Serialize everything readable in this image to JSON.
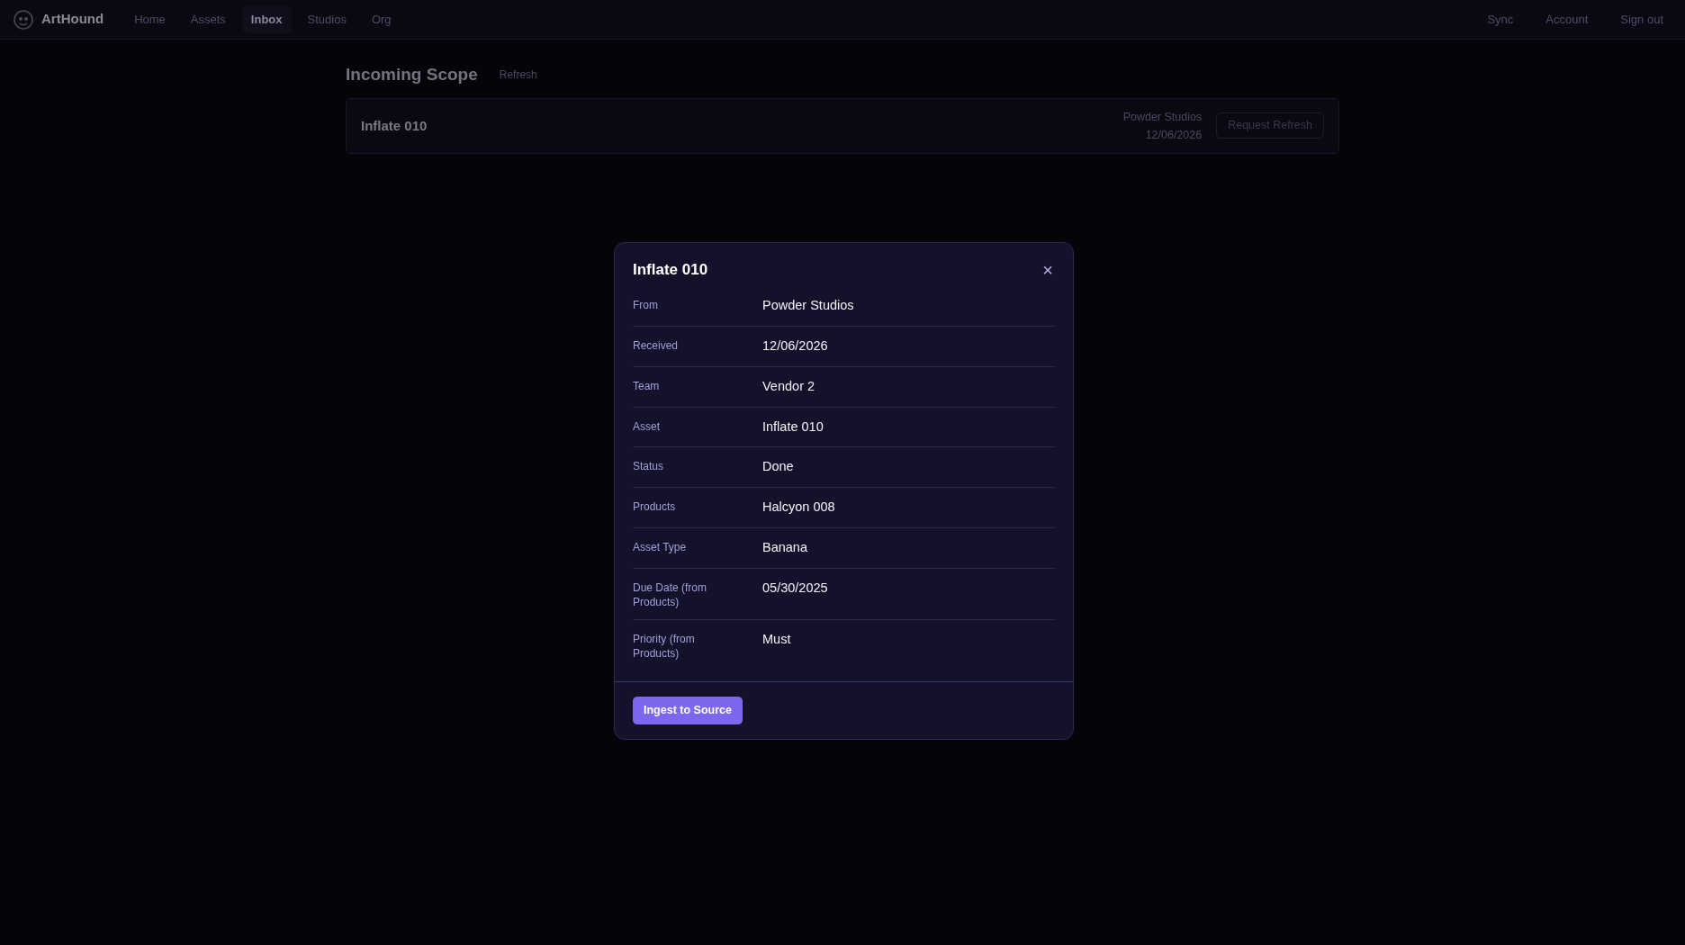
{
  "navbar": {
    "brand": "ArtHound",
    "links": [
      {
        "label": "Home",
        "selected": false
      },
      {
        "label": "Assets",
        "selected": false
      },
      {
        "label": "Inbox",
        "selected": true
      },
      {
        "label": "Studios",
        "selected": false
      },
      {
        "label": "Org",
        "selected": false
      }
    ],
    "right_links": [
      "Sync",
      "Account",
      "Sign out"
    ]
  },
  "page": {
    "title": "Incoming Scope",
    "refresh": "Refresh",
    "items": [
      {
        "name": "Inflate 010",
        "from": "Powder Studios",
        "date": "12/06/2026",
        "action": "Request Refresh",
        "action_disabled": true
      }
    ]
  },
  "modal": {
    "title": "Inflate 010",
    "close": "×",
    "fields": [
      {
        "label": "From",
        "value": "Powder Studios"
      },
      {
        "label": "Received",
        "value": "12/06/2026"
      },
      {
        "label": "Team",
        "value": "Vendor 2"
      },
      {
        "label": "Asset",
        "value": "Inflate 010"
      },
      {
        "label": "Status",
        "value": "Done"
      },
      {
        "label": "Products",
        "value": "Halcyon 008"
      },
      {
        "label": "Asset Type",
        "value": "Banana"
      },
      {
        "label": "Due Date (from Products)",
        "value": "05/30/2025"
      },
      {
        "label": "Priority (from Products)",
        "value": "Must"
      }
    ],
    "button": "Ingest to Source"
  }
}
